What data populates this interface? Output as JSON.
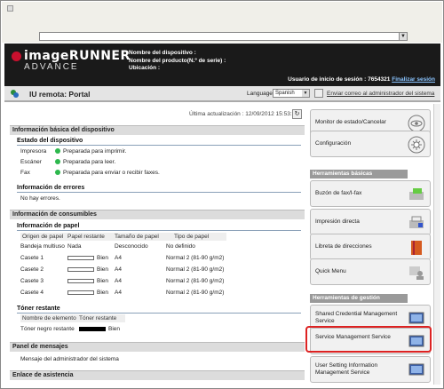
{
  "browser": {
    "address_dropdown": "▼"
  },
  "header": {
    "logo_line1": "imageRUNNER",
    "logo_line2": "ADVANCE",
    "device_name_label": "Nombre del dispositivo :",
    "product_name_label": "Nombre del producto(N.º de serie) :",
    "location_label": "Ubicación :",
    "login_user_label": "Usuario de inicio de sesión : 7654321",
    "logout_link": "Finalizar sesión"
  },
  "portal": {
    "title": "IU remota: Portal",
    "language_label": "Language",
    "language_value": "Spanish",
    "mail_link": "Enviar correo al administrador del sistema"
  },
  "main": {
    "last_update": "Última actualización : 12/09/2012 15:53:10",
    "basic_info_title": "Información básica del dispositivo",
    "device_status_title": "Estado del dispositivo",
    "devices": [
      {
        "name": "Impresora",
        "status": "Preparada para imprimir."
      },
      {
        "name": "Escáner",
        "status": "Preparada para leer."
      },
      {
        "name": "Fax",
        "status": "Preparada para enviar o recibir faxes."
      }
    ],
    "error_info_title": "Información de errores",
    "error_info_value": "No hay errores.",
    "consumables_title": "Información de consumibles",
    "paper_info_title": "Información de papel",
    "paper_headers": [
      "Origen de papel",
      "Papel restante",
      "Tamaño de papel",
      "Tipo de papel"
    ],
    "paper_rows": [
      {
        "source": "Bandeja multiuso",
        "remaining": "Nada",
        "size": "Desconocido",
        "type": "No definido",
        "bar": false
      },
      {
        "source": "Casete 1",
        "remaining": "Bien",
        "size": "A4",
        "type": "Normal 2 (81-90 g/m2)",
        "bar": true
      },
      {
        "source": "Casete 2",
        "remaining": "Bien",
        "size": "A4",
        "type": "Normal 2 (81-90 g/m2)",
        "bar": true
      },
      {
        "source": "Casete 3",
        "remaining": "Bien",
        "size": "A4",
        "type": "Normal 2 (81-90 g/m2)",
        "bar": true
      },
      {
        "source": "Casete 4",
        "remaining": "Bien",
        "size": "A4",
        "type": "Normal 2 (81-90 g/m2)",
        "bar": true
      }
    ],
    "toner_title": "Tóner restante",
    "toner_headers": [
      "Nombre de elemento",
      "Tóner restante"
    ],
    "toner_row": {
      "name": "Tóner negro restante",
      "value": "Bien"
    },
    "message_title": "Panel de mensajes",
    "message_value": "Mensaje del administrador del sistema",
    "support_title": "Enlace de asistencia"
  },
  "right": {
    "status_monitor": "Monitor de estado/Cancelar",
    "settings": "Configuración",
    "basic_tools_title": "Herramientas básicas",
    "fax_box": "Buzón de fax/I-fax",
    "direct_print": "Impresión directa",
    "address_book": "Libreta de direcciones",
    "quick_menu": "Quick Menu",
    "mgmt_tools_title": "Herramientas de gestión",
    "shared_credential": "Shared Credential Management Service",
    "service_mgmt": "Service Management Service",
    "user_setting": "User Setting Information Management Service"
  }
}
